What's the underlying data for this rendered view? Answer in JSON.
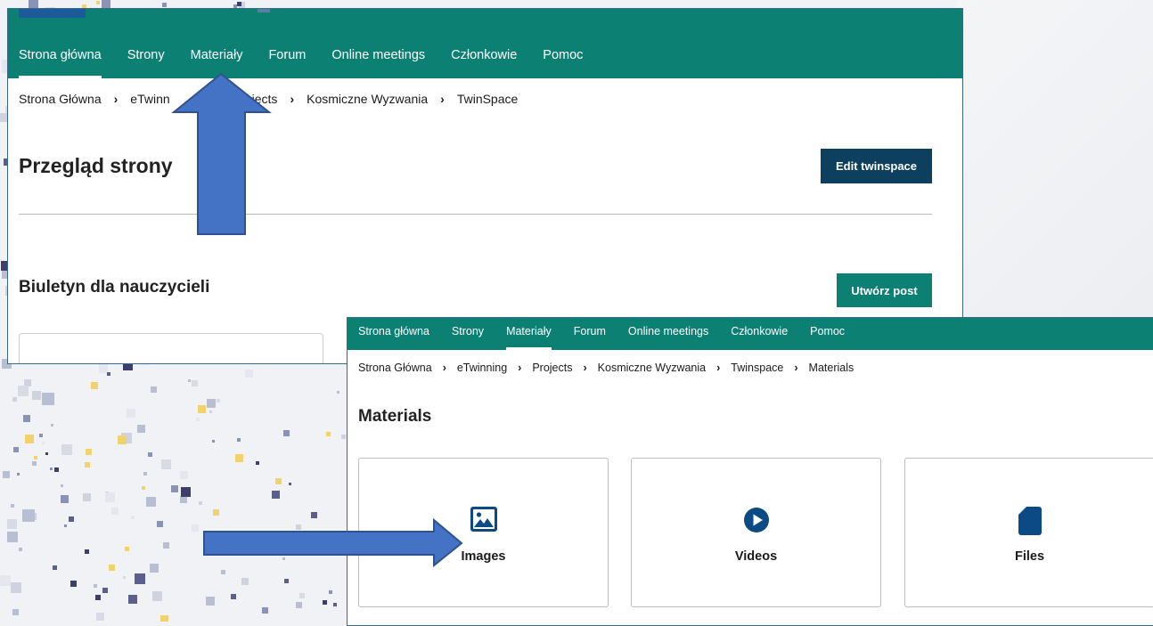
{
  "top_window": {
    "nav": [
      "Strona główna",
      "Strony",
      "Materiały",
      "Forum",
      "Online meetings",
      "Członkowie",
      "Pomoc"
    ],
    "breadcrumb": [
      "Strona Główna",
      "eTwinning",
      "Projects",
      "Kosmiczne Wyzwania",
      "TwinSpace"
    ],
    "breadcrumb_visible": [
      "Strona Główna",
      "eTwinn",
      "jects",
      "Kosmiczne Wyzwania",
      "TwinSpace"
    ],
    "title": "Przegląd strony",
    "edit_button": "Edit twinspace",
    "section_title": "Biuletyn dla nauczycieli",
    "post_button": "Utwórz post"
  },
  "bottom_window": {
    "nav": [
      "Strona główna",
      "Strony",
      "Materiały",
      "Forum",
      "Online meetings",
      "Członkowie",
      "Pomoc"
    ],
    "breadcrumb": [
      "Strona Główna",
      "eTwinning",
      "Projects",
      "Kosmiczne Wyzwania",
      "Twinspace",
      "Materials"
    ],
    "title": "Materials",
    "cards": [
      {
        "label": "Images",
        "icon": "image-icon"
      },
      {
        "label": "Videos",
        "icon": "play-circle-icon"
      },
      {
        "label": "Files",
        "icon": "file-icon"
      }
    ]
  },
  "colors": {
    "nav": "#0b8073",
    "dark_button": "#0d3f5e",
    "icon_blue": "#0c4a86",
    "arrow": "#4472c4"
  }
}
